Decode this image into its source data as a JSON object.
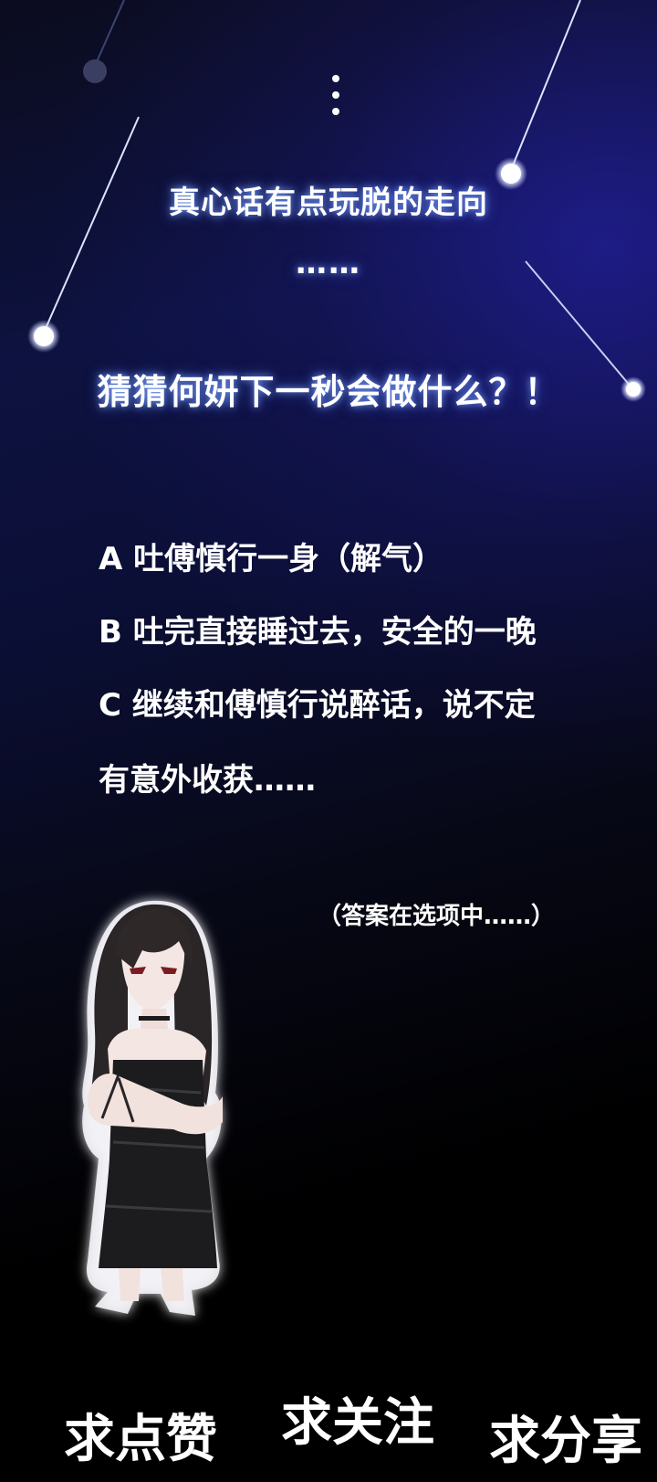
{
  "header": {
    "title_line1": "真心话有点玩脱的走向",
    "ellipsis": "……",
    "title_line2": "猜猜何妍下一秒会做什么？！"
  },
  "options": [
    {
      "label": "A 吐傅慎行一身（解气）"
    },
    {
      "label": "B 吐完直接睡过去，安全的一晚"
    },
    {
      "label": "C 继续和傅慎行说醉话，说不定"
    },
    {
      "label": "有意外收获……"
    }
  ],
  "hint": "（答案在选项中……）",
  "character": {
    "description_icon": "girl-character-illustration"
  },
  "cta": {
    "like": "求点赞",
    "follow": "求关注",
    "share": "求分享"
  },
  "colors": {
    "background_top": "#0d1240",
    "background_bottom": "#000000",
    "text": "#ffffff",
    "glow": "#7aa0ff"
  }
}
